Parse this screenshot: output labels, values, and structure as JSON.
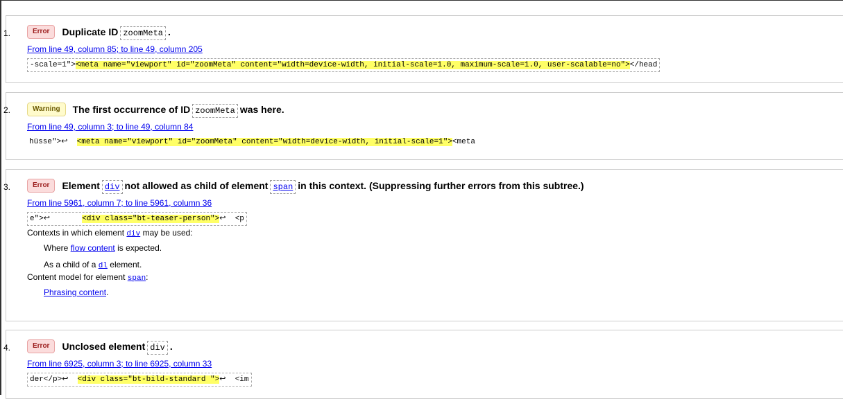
{
  "messages": [
    {
      "number": "1.",
      "type": "Error",
      "title_pre": "Duplicate ID",
      "code": "zoomMeta",
      "title_post": ".",
      "location": "From line 49, column 85; to line 49, column 205",
      "extract_pre": "-scale=1\">",
      "extract_hl": "<meta name=\"viewport\" id=\"zoomMeta\" content=\"width=device-width, initial-scale=1.0, maximum-scale=1.0, user-scalable=no\">",
      "extract_post": "</head"
    },
    {
      "number": "2.",
      "type": "Warning",
      "title_pre": "The first occurrence of ID",
      "code": "zoomMeta",
      "title_post": "was here.",
      "location": "From line 49, column 3; to line 49, column 84",
      "extract_pre": "hüsse\">↩  ",
      "extract_hl": "<meta name=\"viewport\" id=\"zoomMeta\" content=\"width=device-width, initial-scale=1\">",
      "extract_post": "<meta"
    },
    {
      "number": "3.",
      "type": "Error",
      "title_pre": "Element",
      "code": "div",
      "title_mid": "not allowed as child of element",
      "code2": "span",
      "title_post": "in this context. (Suppressing further errors from this subtree.)",
      "location": "From line 5961, column 7; to line 5961, column 36",
      "extract_pre": "e\">↩       ",
      "extract_hl": "<div class=\"bt-teaser-person\">",
      "extract_post": "↩  <p",
      "contexts_label_pre": "Contexts in which element",
      "contexts_label_code": "div",
      "contexts_label_post": "may be used:",
      "where_pre": "Where",
      "where_link": "flow content",
      "where_post": "is expected.",
      "child_pre": "As a child of a",
      "child_code": "dl",
      "child_post": "element.",
      "model_pre": "Content model for element",
      "model_code": "span",
      "model_post": ":",
      "model_link": "Phrasing content",
      "model_link_post": "."
    },
    {
      "number": "4.",
      "type": "Error",
      "title_pre": "Unclosed element",
      "code": "div",
      "title_post": ".",
      "location": "From line 6925, column 3; to line 6925, column 33",
      "extract_pre": "der</p>↩  ",
      "extract_hl": "<div class=\"bt-bild-standard \">",
      "extract_post": "↩  <im"
    }
  ]
}
